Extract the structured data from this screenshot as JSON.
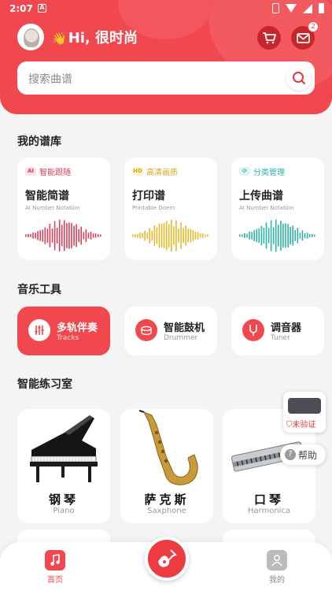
{
  "status_bar": {
    "time": "2:07",
    "notification_icon": "A"
  },
  "header": {
    "greeting": "Hi, 很时尚",
    "wave_icon": "👋",
    "mail_badge": "2",
    "accent_color": "#f0484e"
  },
  "search": {
    "placeholder": "搜索曲谱"
  },
  "library": {
    "title": "我的谱库",
    "cards": [
      {
        "tag_icon": "AI",
        "tag": "智能跟随",
        "title": "智能简谱",
        "subtitle": "AI Number Notation",
        "color": "#d5425a"
      },
      {
        "tag_icon": "HD",
        "tag": "高清画质",
        "title": "打印谱",
        "subtitle": "Printable Ooern",
        "color": "#e7b92a"
      },
      {
        "tag_icon": "⟳",
        "tag": "分类管理",
        "title": "上传曲谱",
        "subtitle": "AI Number Notation",
        "color": "#2fb2a7"
      }
    ]
  },
  "tools": {
    "title": "音乐工具",
    "items": [
      {
        "name": "多轨伴奏",
        "en": "Tracks"
      },
      {
        "name": "智能鼓机",
        "en": "Drummer"
      },
      {
        "name": "调音器",
        "en": "Tuner"
      }
    ]
  },
  "practice": {
    "title": "智能练习室",
    "items": [
      {
        "name": "钢琴",
        "en": "Piano"
      },
      {
        "name": "萨克斯",
        "en": "Saxphone"
      },
      {
        "name": "口琴",
        "en": "Harmonica"
      }
    ]
  },
  "float_widget": {
    "label": "未验证"
  },
  "help": {
    "label": "帮助"
  },
  "bottom_nav": {
    "home": "首页",
    "mine": "我的"
  }
}
